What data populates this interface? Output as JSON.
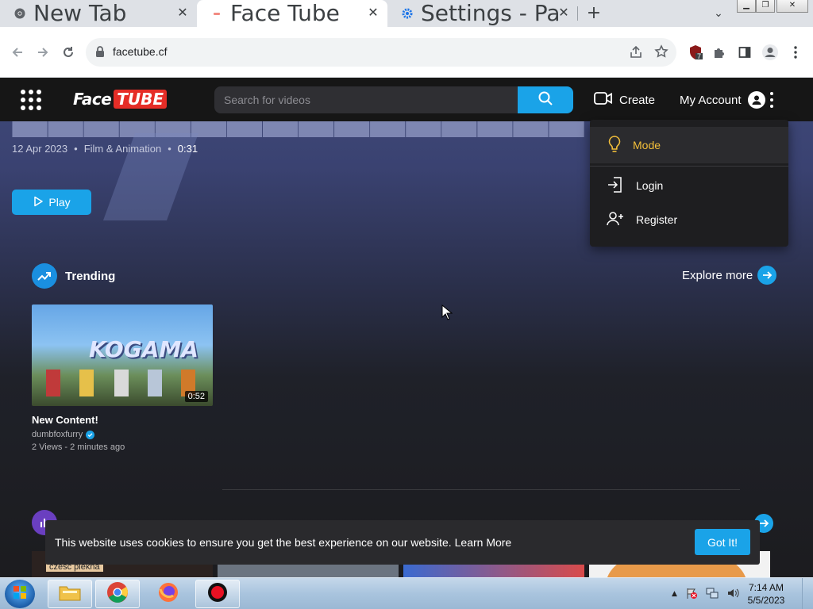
{
  "browser": {
    "tabs": [
      {
        "title": "New Tab",
        "close": "✕"
      },
      {
        "title": "Face Tube",
        "close": "✕"
      },
      {
        "title": "Settings - Pa",
        "close": "✕"
      }
    ],
    "new_tab": "+",
    "tab_search": "⌄",
    "window_controls": {
      "minimize": "▁",
      "maximize": "❐",
      "close": "✕"
    },
    "url": "facetube.cf",
    "extension_badge": "7"
  },
  "site": {
    "logo": {
      "face": "Face",
      "tube": "TUBE"
    },
    "search_placeholder": "Search for videos",
    "create_label": "Create",
    "account_label": "My Account",
    "hero": {
      "date": "12 Apr 2023",
      "category": "Film & Animation",
      "duration": "0:31",
      "play_label": "Play",
      "bullet": "•"
    },
    "menu": {
      "mode": "Mode",
      "login": "Login",
      "register": "Register"
    },
    "trending": {
      "title": "Trending",
      "explore": "Explore more"
    },
    "video": {
      "title": "New Content!",
      "channel": "dumbfoxfurry",
      "meta": "2 Views - 2 minutes ago",
      "duration": "0:52",
      "thumb_text": "KOGAMA"
    },
    "next_thumb_text": "czesc piekna",
    "cookie": {
      "text": "This website uses cookies to ensure you get the best experience on our website.",
      "learn_more": "Learn More",
      "button": "Got It!"
    }
  },
  "taskbar": {
    "time": "7:14 AM",
    "date": "5/5/2023",
    "tray_arrow": "▲"
  },
  "colors": {
    "accent": "#1aa3e8",
    "mode_yellow": "#f3bf3a",
    "logo_red": "#e52d27",
    "navbar": "#161616"
  }
}
